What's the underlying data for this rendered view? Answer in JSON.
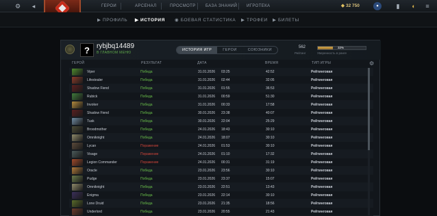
{
  "topbar": {
    "nav": [
      "ГЕРОИ",
      "АРСЕНАЛ",
      "ПРОСМОТР",
      "БАЗА ЗНАНИЙ",
      "ИГРОТЕКА"
    ],
    "coins": "32 750"
  },
  "subnav": {
    "items": [
      "ПРОФИЛЬ",
      "ИСТОРИЯ",
      "БОЕВАЯ СТАТИСТИКА",
      "ТРОФЕИ",
      "БИЛЕТЫ"
    ],
    "active": "ИСТОРИЯ"
  },
  "profile": {
    "avatar_glyph": "?",
    "name": "rybjbq14489",
    "status": "В ГЛАВНОМ МЕНЮ",
    "tabs": [
      "ИСТОРИЯ ИГР",
      "ГЕРОИ",
      "СОЮЗНИКИ"
    ],
    "rating_value": "562",
    "rating_label": "Рейтинг",
    "confidence_pct": 32,
    "confidence_text": "32%",
    "confidence_label": "Уверенность в ранге"
  },
  "table": {
    "columns": [
      "ГЕРОЙ",
      "РЕЗУЛЬТАТ",
      "ДАТА",
      "ВРЕМЯ",
      "ТИП ИГРЫ"
    ],
    "rows": [
      {
        "hero": "Viper",
        "result": "Победа",
        "win": true,
        "date": "31.01.2026",
        "time": "03:25",
        "duration": "42:52",
        "type": "Рейтинговая",
        "color": "#4f8a2e"
      },
      {
        "hero": "Lifestealer",
        "result": "Победа",
        "win": true,
        "date": "31.01.2026",
        "time": "02:44",
        "duration": "32:05",
        "type": "Рейтинговая",
        "color": "#8a3b2a"
      },
      {
        "hero": "Shadow Fiend",
        "result": "Победа",
        "win": true,
        "date": "31.01.2026",
        "time": "01:55",
        "duration": "36:53",
        "type": "Рейтинговая",
        "color": "#5a2020"
      },
      {
        "hero": "Rubick",
        "result": "Победа",
        "win": true,
        "date": "31.01.2026",
        "time": "00:59",
        "duration": "51:30",
        "type": "Рейтинговая",
        "color": "#3f7a3a"
      },
      {
        "hero": "Invoker",
        "result": "Победа",
        "win": true,
        "date": "31.01.2026",
        "time": "00:33",
        "duration": "17:58",
        "type": "Рейтинговая",
        "color": "#b48a3c"
      },
      {
        "hero": "Shadow Fiend",
        "result": "Победа",
        "win": true,
        "date": "30.01.2026",
        "time": "23:38",
        "duration": "40:07",
        "type": "Рейтинговая",
        "color": "#5a2020"
      },
      {
        "hero": "Tusk",
        "result": "Победа",
        "win": true,
        "date": "30.01.2026",
        "time": "22:04",
        "duration": "25:29",
        "type": "Рейтинговая",
        "color": "#6f8aa0"
      },
      {
        "hero": "Broodmother",
        "result": "Победа",
        "win": true,
        "date": "24.01.2026",
        "time": "18:43",
        "duration": "30:10",
        "type": "Рейтинговая",
        "color": "#4a4a36"
      },
      {
        "hero": "Omniknight",
        "result": "Победа",
        "win": true,
        "date": "24.01.2026",
        "time": "18:07",
        "duration": "30:10",
        "type": "Рейтинговая",
        "color": "#8f8a6a"
      },
      {
        "hero": "Lycan",
        "result": "Поражение",
        "win": false,
        "date": "24.01.2026",
        "time": "01:53",
        "duration": "30:10",
        "type": "Рейтинговая",
        "color": "#5b4a3a"
      },
      {
        "hero": "Visage",
        "result": "Поражение",
        "win": false,
        "date": "24.01.2026",
        "time": "01:10",
        "duration": "17:32",
        "type": "Рейтинговая",
        "color": "#4b5a5a"
      },
      {
        "hero": "Legion Commander",
        "result": "Поражение",
        "win": false,
        "date": "24.01.2026",
        "time": "00:31",
        "duration": "31:19",
        "type": "Рейтинговая",
        "color": "#a04a2a"
      },
      {
        "hero": "Oracle",
        "result": "Победа",
        "win": true,
        "date": "23.01.2026",
        "time": "23:56",
        "duration": "30:10",
        "type": "Рейтинговая",
        "color": "#b07a3a"
      },
      {
        "hero": "Pudge",
        "result": "Победа",
        "win": true,
        "date": "23.01.2026",
        "time": "23:37",
        "duration": "15:07",
        "type": "Рейтинговая",
        "color": "#6a7a4a"
      },
      {
        "hero": "Omniknight",
        "result": "Победа",
        "win": true,
        "date": "23.01.2026",
        "time": "22:51",
        "duration": "13:43",
        "type": "Рейтинговая",
        "color": "#8f8a6a"
      },
      {
        "hero": "Enigma",
        "result": "Победа",
        "win": true,
        "date": "23.01.2026",
        "time": "22:14",
        "duration": "30:10",
        "type": "Рейтинговая",
        "color": "#3a2f5a"
      },
      {
        "hero": "Lone Druid",
        "result": "Победа",
        "win": true,
        "date": "23.01.2026",
        "time": "21:35",
        "duration": "18:56",
        "type": "Рейтинговая",
        "color": "#5a6a2a"
      },
      {
        "hero": "Underlord",
        "result": "Победа",
        "win": true,
        "date": "23.01.2026",
        "time": "20:55",
        "duration": "21:43",
        "type": "Рейтинговая",
        "color": "#6a3a2a"
      }
    ]
  }
}
